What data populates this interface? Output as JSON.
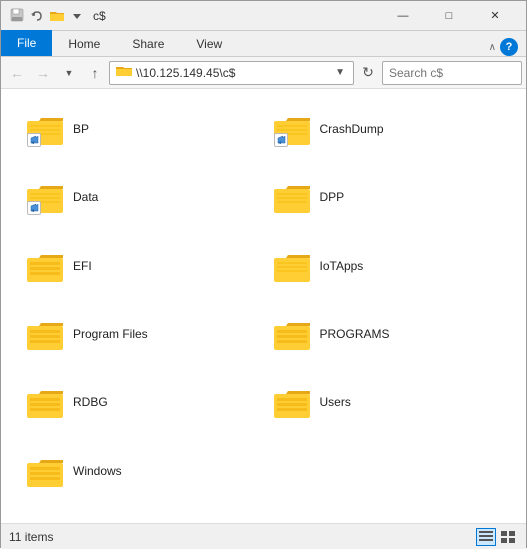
{
  "window": {
    "title": "c$",
    "titlebar_icons": [
      "📁"
    ],
    "controls": {
      "minimize": "—",
      "maximize": "□",
      "close": "✕"
    }
  },
  "ribbon": {
    "tabs": [
      {
        "label": "File",
        "active": true
      },
      {
        "label": "Home",
        "active": false
      },
      {
        "label": "Share",
        "active": false
      },
      {
        "label": "View",
        "active": false
      }
    ],
    "chevron": "∨"
  },
  "address_bar": {
    "path": "\\\\10.125.149.45\\c$",
    "placeholder": "",
    "search_placeholder": "Search c$"
  },
  "nav": {
    "back": "←",
    "forward": "→",
    "up": "↑"
  },
  "folders": [
    {
      "name": "BP",
      "has_badge": true,
      "badge_type": "shortcut"
    },
    {
      "name": "CrashDump",
      "has_badge": true,
      "badge_type": "shortcut"
    },
    {
      "name": "Data",
      "has_badge": true,
      "badge_type": "shortcut"
    },
    {
      "name": "DPP",
      "has_badge": false,
      "badge_type": "none"
    },
    {
      "name": "EFI",
      "has_badge": false,
      "badge_type": "none"
    },
    {
      "name": "IoTApps",
      "has_badge": false,
      "badge_type": "none"
    },
    {
      "name": "Program Files",
      "has_badge": false,
      "badge_type": "none"
    },
    {
      "name": "PROGRAMS",
      "has_badge": false,
      "badge_type": "none"
    },
    {
      "name": "RDBG",
      "has_badge": false,
      "badge_type": "none"
    },
    {
      "name": "Users",
      "has_badge": false,
      "badge_type": "none"
    },
    {
      "name": "Windows",
      "has_badge": false,
      "badge_type": "none"
    }
  ],
  "status": {
    "items_count": "11 items"
  },
  "colors": {
    "accent": "#0078d7",
    "folder_body": "#FFCE35",
    "folder_tab": "#E6A817",
    "folder_dark": "#FFCE35"
  }
}
